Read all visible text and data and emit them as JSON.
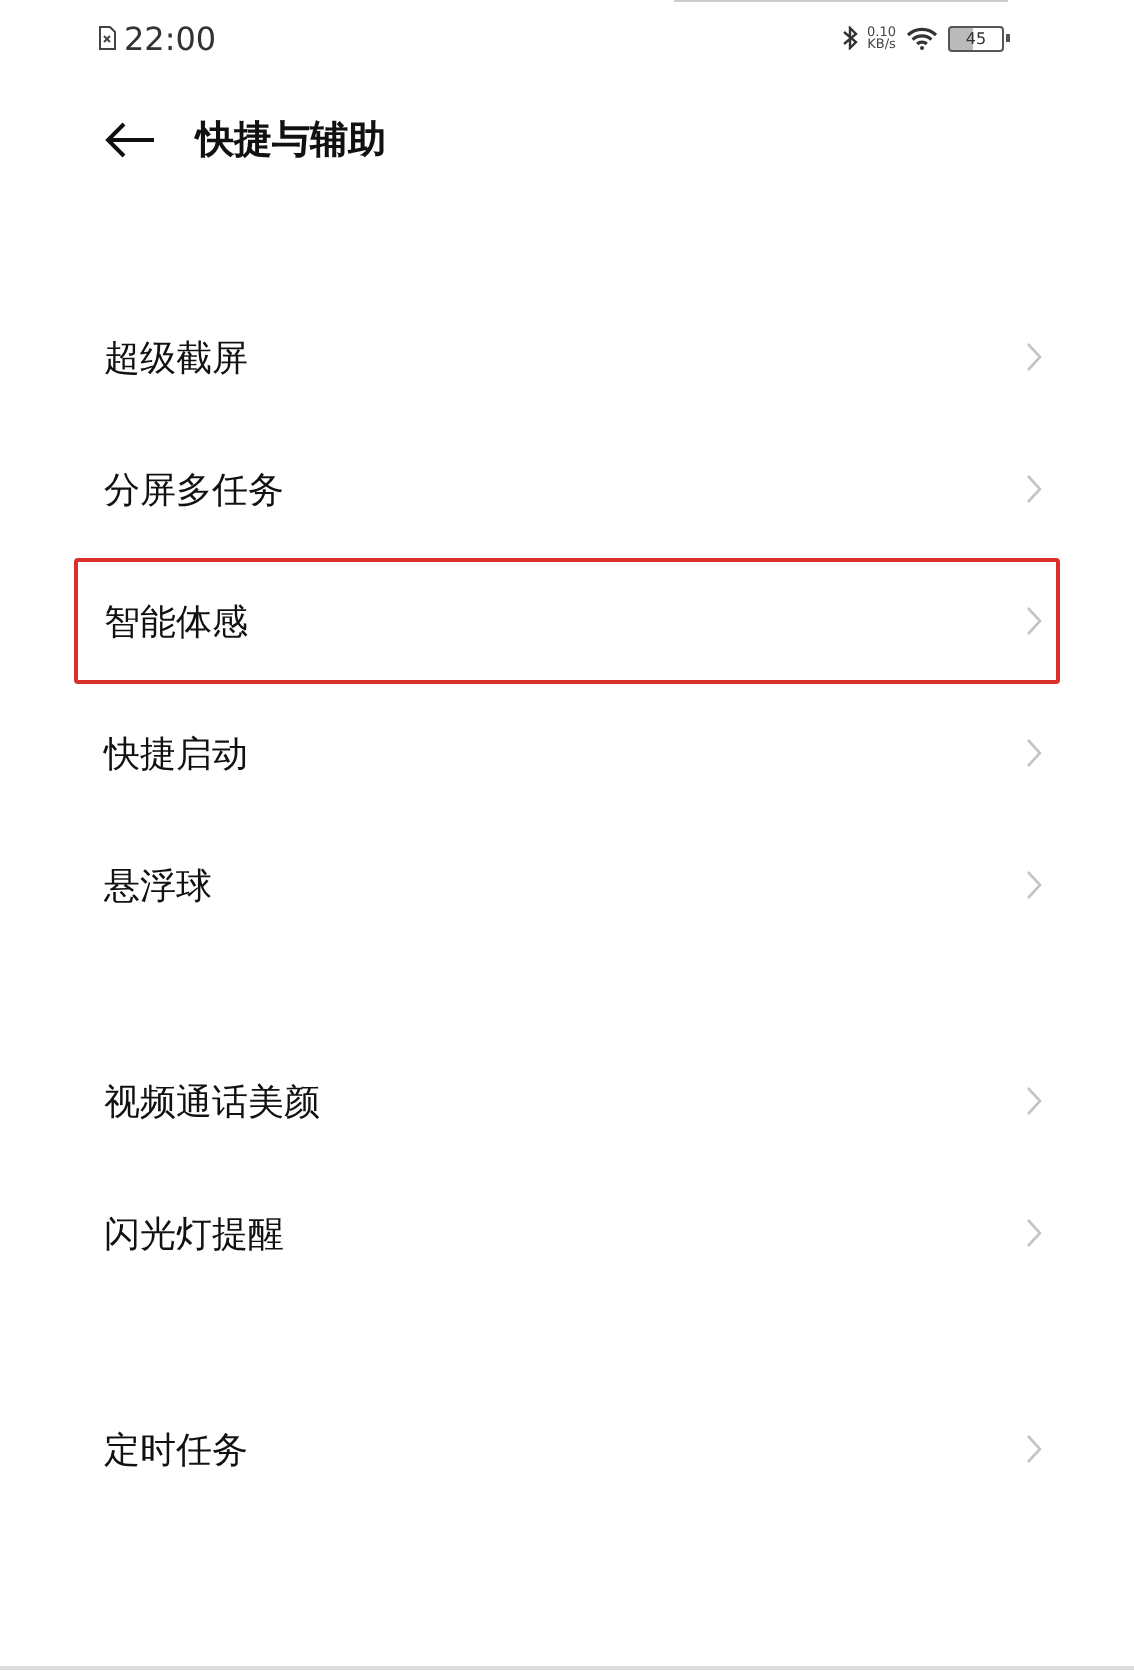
{
  "status_bar": {
    "time": "22:00",
    "net_speed": "0.10",
    "net_unit": "KB/s",
    "battery": "45"
  },
  "header": {
    "title": "快捷与辅助"
  },
  "groups": [
    {
      "items": [
        {
          "label": "超级截屏",
          "highlighted": false
        },
        {
          "label": "分屏多任务",
          "highlighted": false
        },
        {
          "label": "智能体感",
          "highlighted": true
        },
        {
          "label": "快捷启动",
          "highlighted": false
        },
        {
          "label": "悬浮球",
          "highlighted": false
        }
      ]
    },
    {
      "items": [
        {
          "label": "视频通话美颜",
          "highlighted": false
        },
        {
          "label": "闪光灯提醒",
          "highlighted": false
        }
      ]
    },
    {
      "items": [
        {
          "label": "定时任务",
          "highlighted": false
        }
      ]
    }
  ]
}
